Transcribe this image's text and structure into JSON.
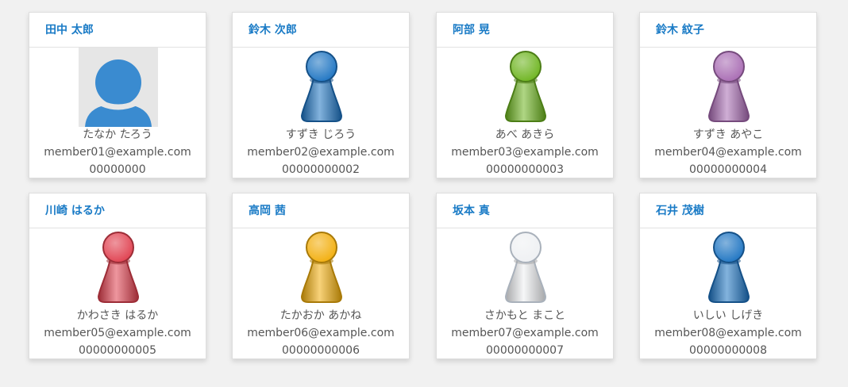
{
  "members": [
    {
      "name": "田中 太郎",
      "kana": "たなか たろう",
      "email": "member01@example.com",
      "phone": "00000000",
      "icon": "default-user-icon",
      "color": "#3a8bd0"
    },
    {
      "name": "鈴木 次郎",
      "kana": "すずき じろう",
      "email": "member02@example.com",
      "phone": "00000000002",
      "icon": "pawn-icon",
      "color": "#1e74c2"
    },
    {
      "name": "阿部 晃",
      "kana": "あべ あきら",
      "email": "member03@example.com",
      "phone": "00000000003",
      "icon": "pawn-icon",
      "color": "#6db41f"
    },
    {
      "name": "鈴木 紋子",
      "kana": "すずき あやこ",
      "email": "member04@example.com",
      "phone": "00000000004",
      "icon": "pawn-icon",
      "color": "#a86bb3"
    },
    {
      "name": "川崎 はるか",
      "kana": "かわさき はるか",
      "email": "member05@example.com",
      "phone": "00000000005",
      "icon": "pawn-icon",
      "color": "#e0404f"
    },
    {
      "name": "高岡 茜",
      "kana": "たかおか あかね",
      "email": "member06@example.com",
      "phone": "00000000006",
      "icon": "pawn-icon",
      "color": "#f2ae0c"
    },
    {
      "name": "坂本 真",
      "kana": "さかもと まこと",
      "email": "member07@example.com",
      "phone": "00000000007",
      "icon": "pawn-icon",
      "color": "#eef0f3"
    },
    {
      "name": "石井 茂樹",
      "kana": "いしい しげき",
      "email": "member08@example.com",
      "phone": "00000000008",
      "icon": "pawn-icon",
      "color": "#1e74c2"
    }
  ],
  "colors": {
    "name_text": "#1a7bc6",
    "body_text": "#555555",
    "background": "#f1f1f1"
  }
}
